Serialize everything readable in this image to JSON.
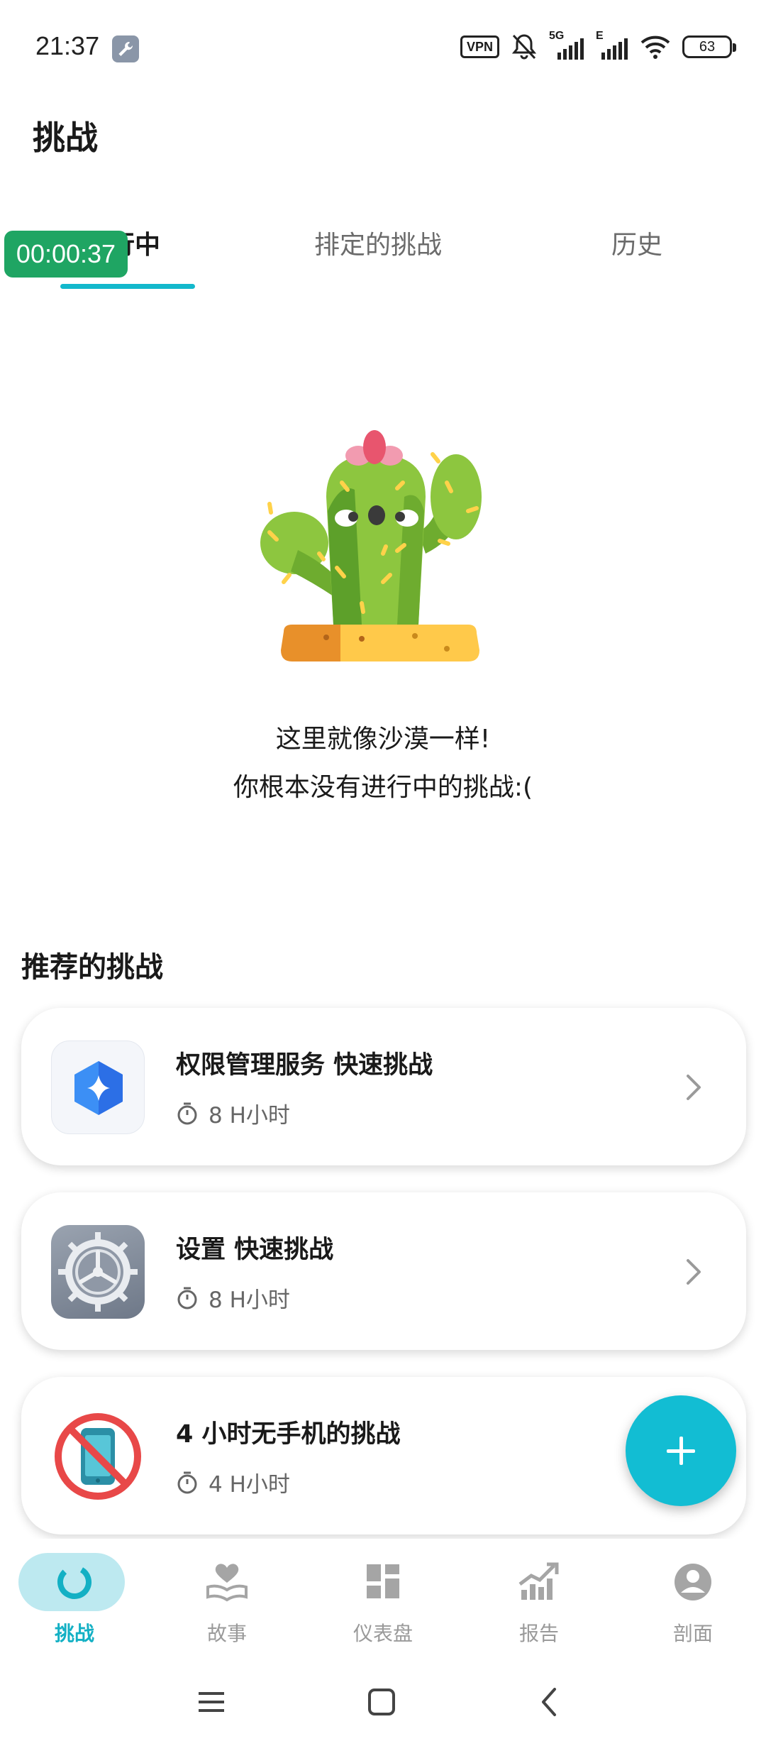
{
  "status_bar": {
    "time": "21:37",
    "vpn": "VPN",
    "network_5g": "5G",
    "network_e": "E",
    "battery": "63",
    "icons": [
      "wrench-icon",
      "bell-muted-icon",
      "signal-icon",
      "wifi-icon",
      "battery-icon"
    ]
  },
  "header": {
    "title": "挑战"
  },
  "tabs": [
    {
      "label": "进行中",
      "active": true
    },
    {
      "label": "排定的挑战",
      "active": false
    },
    {
      "label": "历史",
      "active": false
    }
  ],
  "timer_overlay": "00:00:37",
  "empty_state": {
    "line1": "这里就像沙漠一样!",
    "line2": "你根本没有进行中的挑战:("
  },
  "recommended": {
    "title": "推荐的挑战",
    "items": [
      {
        "title": "权限管理服务 快速挑战",
        "duration": "8 H小时",
        "icon": "permission-service-icon"
      },
      {
        "title": "设置 快速挑战",
        "duration": "8 H小时",
        "icon": "settings-gear-icon"
      },
      {
        "title": "4 小时无手机的挑战",
        "duration": "4 H小时",
        "icon": "no-phone-icon"
      }
    ]
  },
  "bottom_nav": [
    {
      "label": "挑战",
      "active": true
    },
    {
      "label": "故事",
      "active": false
    },
    {
      "label": "仪表盘",
      "active": false
    },
    {
      "label": "报告",
      "active": false
    },
    {
      "label": "剖面",
      "active": false
    }
  ],
  "colors": {
    "accent": "#13b8cc",
    "timer_green": "#1fa563",
    "nav_active_bg": "#bde9f0"
  }
}
